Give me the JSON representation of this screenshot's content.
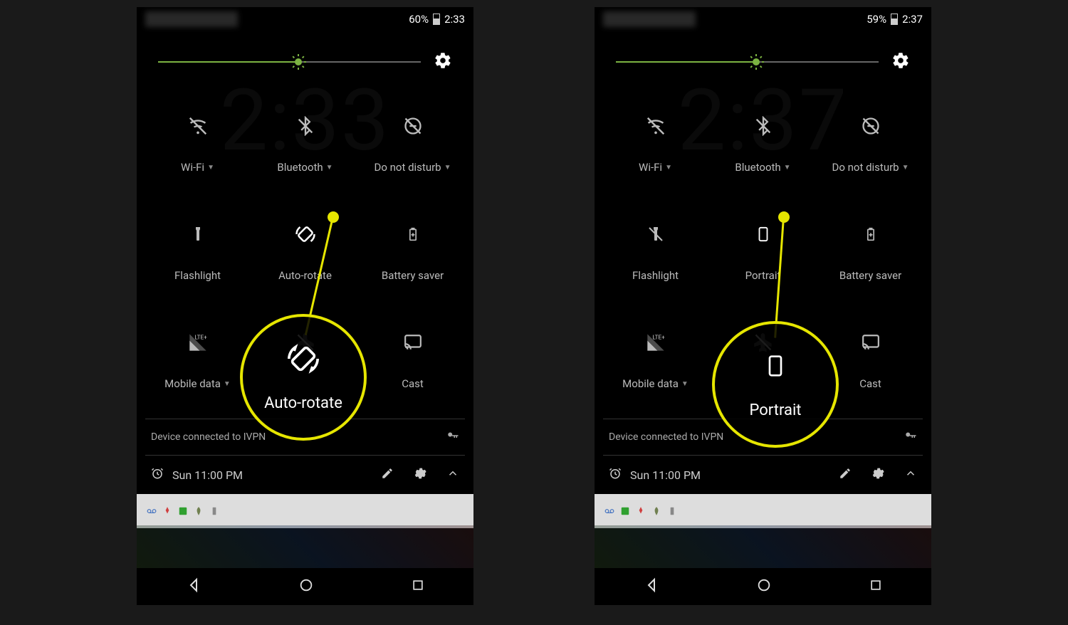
{
  "left": {
    "status": {
      "battery": "60%",
      "time": "2:33"
    },
    "bgTime": "2:33",
    "tiles": {
      "r1": [
        "Wi-Fi",
        "Bluetooth",
        "Do not disturb"
      ],
      "r2": [
        "Flashlight",
        "Auto-rotate",
        "Battery saver"
      ],
      "r3": [
        "Mobile data",
        "",
        "Cast"
      ]
    },
    "vpn": "Device connected to IVPN",
    "alarm": "Sun 11:00 PM",
    "callout": {
      "label": "Auto-rotate"
    }
  },
  "right": {
    "status": {
      "battery": "59%",
      "time": "2:37"
    },
    "bgTime": "2:37",
    "tiles": {
      "r1": [
        "Wi-Fi",
        "Bluetooth",
        "Do not disturb"
      ],
      "r2": [
        "Flashlight",
        "Portrait",
        "Battery saver"
      ],
      "r3": [
        "Mobile data",
        "",
        "Cast"
      ]
    },
    "vpn": "Device connected to IVPN",
    "alarm": "Sun 11:00 PM",
    "callout": {
      "label": "Portrait"
    }
  }
}
